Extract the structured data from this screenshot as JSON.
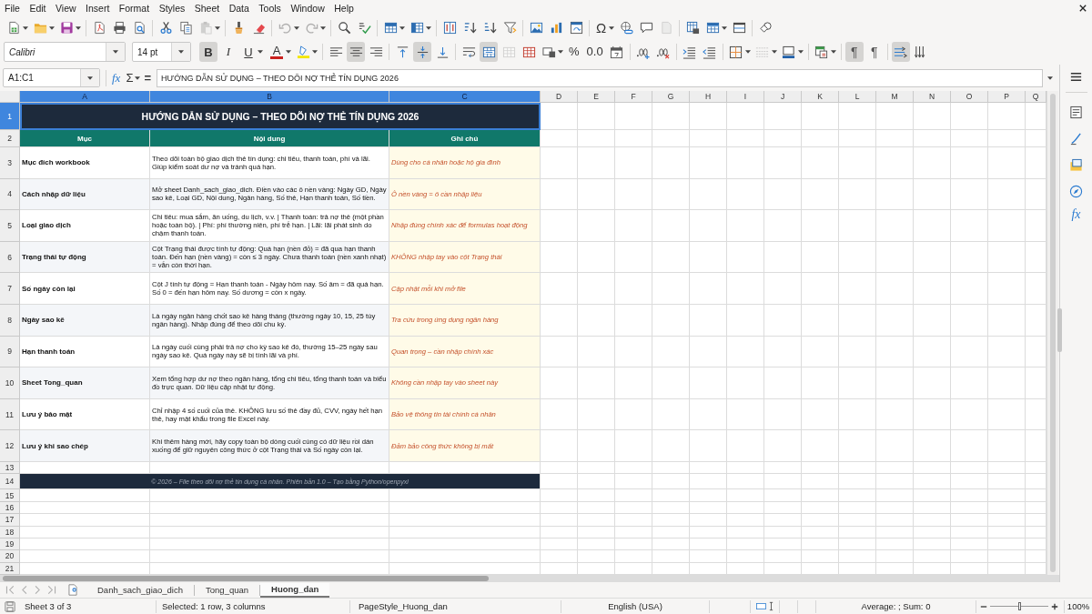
{
  "menu": [
    "File",
    "Edit",
    "View",
    "Insert",
    "Format",
    "Styles",
    "Sheet",
    "Data",
    "Tools",
    "Window",
    "Help"
  ],
  "standard_toolbar": {
    "paste": {
      "disabled": true
    },
    "undo": {
      "disabled": true
    },
    "redo": {
      "disabled": true
    },
    "special_character": "Ω",
    "header_footer": {
      "disabled": true
    }
  },
  "format_toolbar": {
    "font_name": "Calibri",
    "font_size": "14 pt",
    "bold": {
      "label": "B",
      "on": true
    },
    "italic": {
      "label": "I",
      "on": false
    },
    "underline": {
      "label": "U",
      "on": false
    },
    "font_color": "A",
    "align_left": {
      "on": false
    },
    "align_center": {
      "on": true
    },
    "align_right": {
      "on": false
    },
    "align_top": {
      "on": false
    },
    "align_middle": {
      "on": true
    },
    "align_bottom": {
      "on": false
    },
    "wrap_text": {
      "on": false
    },
    "merge_center": {
      "on": true
    },
    "merge_cells": {
      "disabled": true
    },
    "percent": "%",
    "number_format": "0.0",
    "border_style": {
      "disabled": true
    },
    "left_to_right": {
      "label": "¶",
      "on": true
    },
    "right_to_left": {
      "label": "¶",
      "on": false
    },
    "text_horizontal": {
      "on": true
    },
    "text_vertical": {
      "on": false
    }
  },
  "formula_bar": {
    "name_box": "A1:C1",
    "function_wizard": "fx",
    "sum": "Σ",
    "equals": "=",
    "content": "HƯỚNG DẪN SỬ DỤNG – THEO DÕI NỢ THẺ TÍN DỤNG 2026"
  },
  "sidebar": {
    "functions": "fx"
  },
  "sheet": {
    "columns": [
      {
        "label": "A",
        "selected": true
      },
      {
        "label": "B",
        "selected": true
      },
      {
        "label": "C",
        "selected": true
      },
      {
        "label": "D",
        "selected": false
      },
      {
        "label": "E",
        "selected": false
      },
      {
        "label": "F",
        "selected": false
      },
      {
        "label": "G",
        "selected": false
      },
      {
        "label": "H",
        "selected": false
      },
      {
        "label": "I",
        "selected": false
      },
      {
        "label": "J",
        "selected": false
      },
      {
        "label": "K",
        "selected": false
      },
      {
        "label": "L",
        "selected": false
      },
      {
        "label": "M",
        "selected": false
      },
      {
        "label": "N",
        "selected": false
      },
      {
        "label": "O",
        "selected": false
      },
      {
        "label": "P",
        "selected": false
      },
      {
        "label": "Q",
        "selected": false
      }
    ],
    "rows": [
      {
        "number": "1",
        "selected": true,
        "kind": "title",
        "text": "HƯỚNG DẪN SỬ DỤNG – THEO DÕI NỢ THẺ TÍN DỤNG 2026"
      },
      {
        "number": "2",
        "selected": false,
        "kind": "header",
        "cells": [
          "Mục",
          "Nội dung",
          "Ghi chú"
        ]
      },
      {
        "number": "3",
        "selected": false,
        "kind": "entry",
        "cells": [
          "Mục đích workbook",
          "Theo dõi toàn bộ giao dịch thẻ tín dụng: chi tiêu, thanh toán, phí và lãi. Giúp kiểm soát dư nợ và tránh quá hạn.",
          "Dùng cho cá nhân hoặc hộ gia đình"
        ]
      },
      {
        "number": "4",
        "selected": false,
        "kind": "entry",
        "cells": [
          "Cách nhập dữ liệu",
          "Mở sheet Danh_sach_giao_dich. Điền vào các ô nền vàng: Ngày GD, Ngày sao kê, Loại GD, Nội dung, Ngân hàng, Số thẻ, Hạn thanh toán, Số tiền.",
          "Ô nền vàng = ô cần nhập liệu"
        ]
      },
      {
        "number": "5",
        "selected": false,
        "kind": "entry",
        "cells": [
          "Loại giao dịch",
          "Chi tiêu: mua sắm, ăn uống, du lịch, v.v. | Thanh toán: trả nợ thẻ (một phần hoặc toàn bộ). | Phí: phí thường niên, phí trễ hạn. | Lãi: lãi phát sinh do chậm thanh toán.",
          "Nhập đúng chính xác để formulas hoạt động"
        ]
      },
      {
        "number": "6",
        "selected": false,
        "kind": "entry",
        "cells": [
          "Trạng thái tự động",
          "Cột Trạng thái được tính tự động: Quá hạn (nền đỏ) = đã qua hạn thanh toán. Đến hạn (nền vàng) = còn ≤ 3 ngày. Chưa thanh toán (nền xanh nhạt) = vẫn còn thời hạn.",
          "KHÔNG nhập tay vào cột Trạng thái"
        ]
      },
      {
        "number": "7",
        "selected": false,
        "kind": "entry",
        "cells": [
          "Số ngày còn lại",
          "Cột J tính tự động = Hạn thanh toán - Ngày hôm nay. Số âm = đã quá hạn. Số 0 = đến hạn hôm nay. Số dương = còn x ngày.",
          "Cập nhật mỗi khi mở file"
        ]
      },
      {
        "number": "8",
        "selected": false,
        "kind": "entry",
        "cells": [
          "Ngày sao kê",
          "Là ngày ngân hàng chốt sao kê hàng tháng (thường ngày 10, 15, 25 tùy ngân hàng). Nhập đúng để theo dõi chu kỳ.",
          "Tra cứu trong ứng dụng ngân hàng"
        ]
      },
      {
        "number": "9",
        "selected": false,
        "kind": "entry",
        "cells": [
          "Hạn thanh toán",
          "Là ngày cuối cùng phải trả nợ cho kỳ sao kê đó, thường 15–25 ngày sau ngày sao kê. Quá ngày này sẽ bị tính lãi và phí.",
          "Quan trọng – cần nhập chính xác"
        ]
      },
      {
        "number": "10",
        "selected": false,
        "kind": "entry",
        "cells": [
          "Sheet Tong_quan",
          "Xem tổng hợp dư nợ theo ngân hàng, tổng chi tiêu, tổng thanh toán và biểu đồ trực quan. Dữ liệu cập nhật tự động.",
          "Không cần nhập tay vào sheet này"
        ]
      },
      {
        "number": "11",
        "selected": false,
        "kind": "entry",
        "cells": [
          "Lưu ý bảo mật",
          "Chỉ nhập 4 số cuối của thẻ. KHÔNG lưu số thẻ đầy đủ, CVV, ngày hết hạn thẻ, hay mật khẩu trong file Excel này.",
          "Bảo vệ thông tin tài chính cá nhân"
        ]
      },
      {
        "number": "12",
        "selected": false,
        "kind": "entry",
        "cells": [
          "Lưu ý khi sao chép",
          "Khi thêm hàng mới, hãy copy toàn bộ dòng cuối cùng có dữ liệu rồi dán xuống để giữ nguyên công thức ở cột Trạng thái và Số ngày còn lại.",
          "Đảm bảo công thức không bị mất"
        ]
      },
      {
        "number": "13",
        "selected": false,
        "kind": "blank"
      },
      {
        "number": "14",
        "selected": false,
        "kind": "footer",
        "text": "© 2026 – File theo dõi nợ thẻ tín dụng cá nhân. Phiên bản 1.0 – Tạo bằng Python/openpyxl"
      },
      {
        "number": "15",
        "selected": false,
        "kind": "blank"
      },
      {
        "number": "16",
        "selected": false,
        "kind": "blank"
      },
      {
        "number": "17",
        "selected": false,
        "kind": "blank"
      },
      {
        "number": "18",
        "selected": false,
        "kind": "blank"
      },
      {
        "number": "19",
        "selected": false,
        "kind": "blank"
      },
      {
        "number": "20",
        "selected": false,
        "kind": "blank"
      },
      {
        "number": "21",
        "selected": false,
        "kind": "blank"
      }
    ]
  },
  "sheet_tabs": [
    {
      "label": "Danh_sach_giao_dich",
      "selected": false
    },
    {
      "label": "Tong_quan",
      "selected": false
    },
    {
      "label": "Huong_dan",
      "selected": true
    }
  ],
  "status_bar": {
    "sheet": "Sheet 3 of 3",
    "selection": "Selected: 1 row, 3 columns",
    "page_style": "PageStyle_Huong_dan",
    "language": "English (USA)",
    "sum": "Average: ; Sum: 0",
    "zoom": {
      "level": 0.5,
      "label": "100%"
    }
  }
}
